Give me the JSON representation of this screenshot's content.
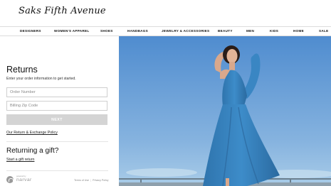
{
  "header": {
    "logo_text": "Saks Fifth Avenue"
  },
  "nav": {
    "items": [
      {
        "label": "DESIGNERS"
      },
      {
        "label": "WOMEN'S APPAREL"
      },
      {
        "label": "SHOES"
      },
      {
        "label": "HANDBAGS"
      },
      {
        "label": "JEWELRY & ACCESSORIES"
      },
      {
        "label": "BEAUTY"
      },
      {
        "label": "MEN"
      },
      {
        "label": "KIDS"
      },
      {
        "label": "HOME"
      },
      {
        "label": "SALE"
      }
    ]
  },
  "returns": {
    "title": "Returns",
    "subtitle": "Enter your order information to get started.",
    "order_number_placeholder": "Order Number",
    "order_number_value": "",
    "zip_placeholder": "Billing Zip Code",
    "zip_value": "",
    "next_label": "NEXT",
    "policy_link": "Our Return & Exchange Policy"
  },
  "gift": {
    "title": "Returning a gift?",
    "link": "Start a gift return"
  },
  "footer": {
    "powered_by": "powered by",
    "brand": "narvar",
    "terms": "Terms of Use",
    "privacy": "Privacy Policy"
  },
  "colors": {
    "sky_top": "#4f8ccf",
    "sky_bottom": "#a9cce8",
    "dress": "#3a86c3",
    "next_button": "#d4d4d4"
  },
  "hero": {
    "description": "model-in-blue-one-shoulder-gown"
  }
}
